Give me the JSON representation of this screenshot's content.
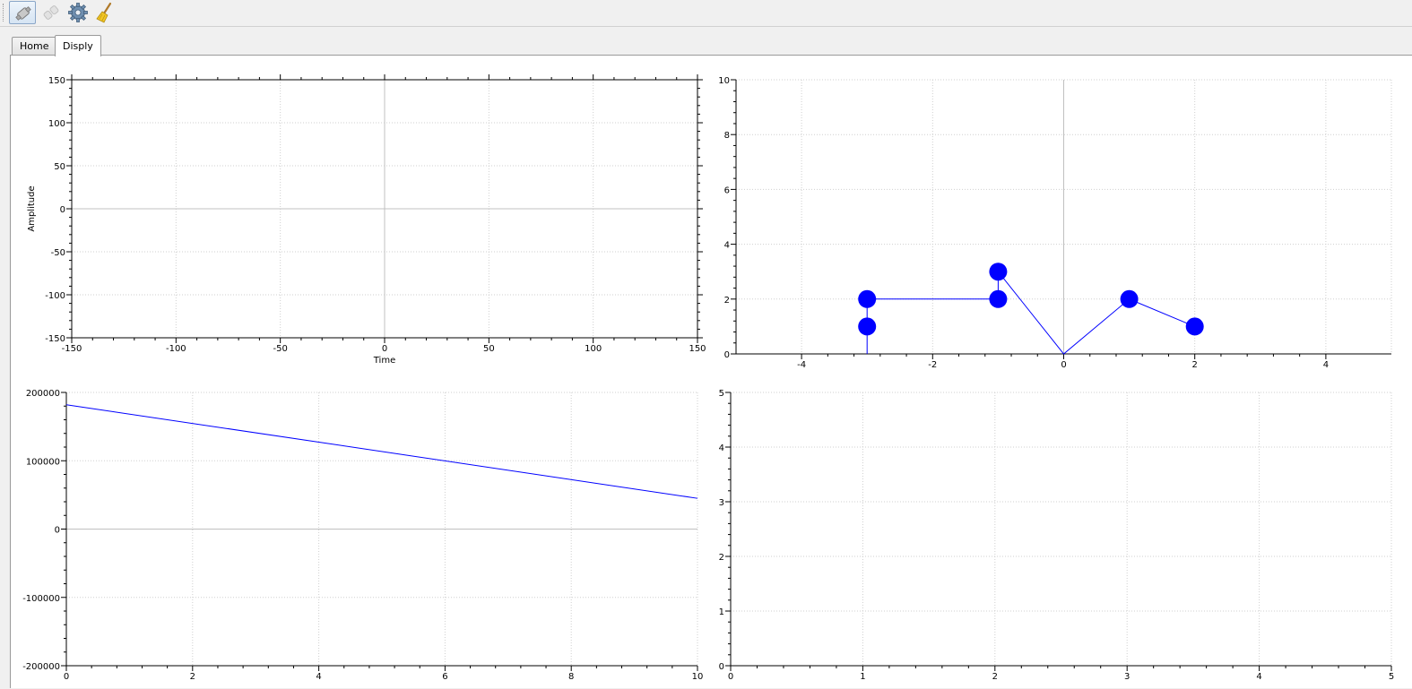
{
  "toolbar": {
    "buttons": [
      {
        "icon": "connect-icon",
        "active": true
      },
      {
        "icon": "disconnect-icon",
        "active": false
      },
      {
        "icon": "settings-gear-icon",
        "active": false
      },
      {
        "icon": "clear-broom-icon",
        "active": false
      }
    ]
  },
  "tabs": [
    {
      "label": "Home",
      "selected": false
    },
    {
      "label": "Disply",
      "selected": true
    }
  ],
  "chart_data": [
    {
      "type": "line",
      "xlabel": "Time",
      "ylabel": "Amplitude",
      "xlim": [
        -150,
        150
      ],
      "ylim": [
        -150,
        150
      ],
      "xticks": [
        -150,
        -100,
        -50,
        0,
        50,
        100,
        150
      ],
      "yticks": [
        -150,
        -100,
        -50,
        0,
        50,
        100,
        150
      ],
      "grid": true,
      "series": []
    },
    {
      "type": "line",
      "xlabel": "",
      "ylabel": "",
      "xlim": [
        -5,
        5
      ],
      "ylim": [
        0,
        10
      ],
      "xticks": [
        -4,
        -2,
        0,
        2,
        4
      ],
      "yticks": [
        0,
        2,
        4,
        6,
        8,
        10
      ],
      "grid": true,
      "series": [
        {
          "color": "#0000ff",
          "marker": "circle",
          "x": [
            -3,
            -3,
            -3,
            -1,
            -1,
            0,
            1,
            2
          ],
          "y": [
            0,
            1,
            2,
            2,
            3,
            0,
            2,
            1
          ],
          "markers": [
            false,
            true,
            true,
            true,
            true,
            false,
            true,
            true
          ]
        }
      ]
    },
    {
      "type": "line",
      "xlabel": "",
      "ylabel": "",
      "xlim": [
        0,
        10
      ],
      "ylim": [
        -200000,
        200000
      ],
      "xticks": [
        0,
        2,
        4,
        6,
        8,
        10
      ],
      "yticks": [
        -200000,
        -100000,
        0,
        100000,
        200000
      ],
      "grid": true,
      "series": [
        {
          "color": "#0000ff",
          "x": [
            0,
            10
          ],
          "y": [
            182000,
            45000
          ]
        }
      ]
    },
    {
      "type": "line",
      "xlabel": "",
      "ylabel": "",
      "xlim": [
        0,
        5
      ],
      "ylim": [
        0,
        5
      ],
      "xticks": [
        0,
        1,
        2,
        3,
        4,
        5
      ],
      "yticks": [
        0,
        1,
        2,
        3,
        4,
        5
      ],
      "grid": true,
      "series": []
    }
  ]
}
